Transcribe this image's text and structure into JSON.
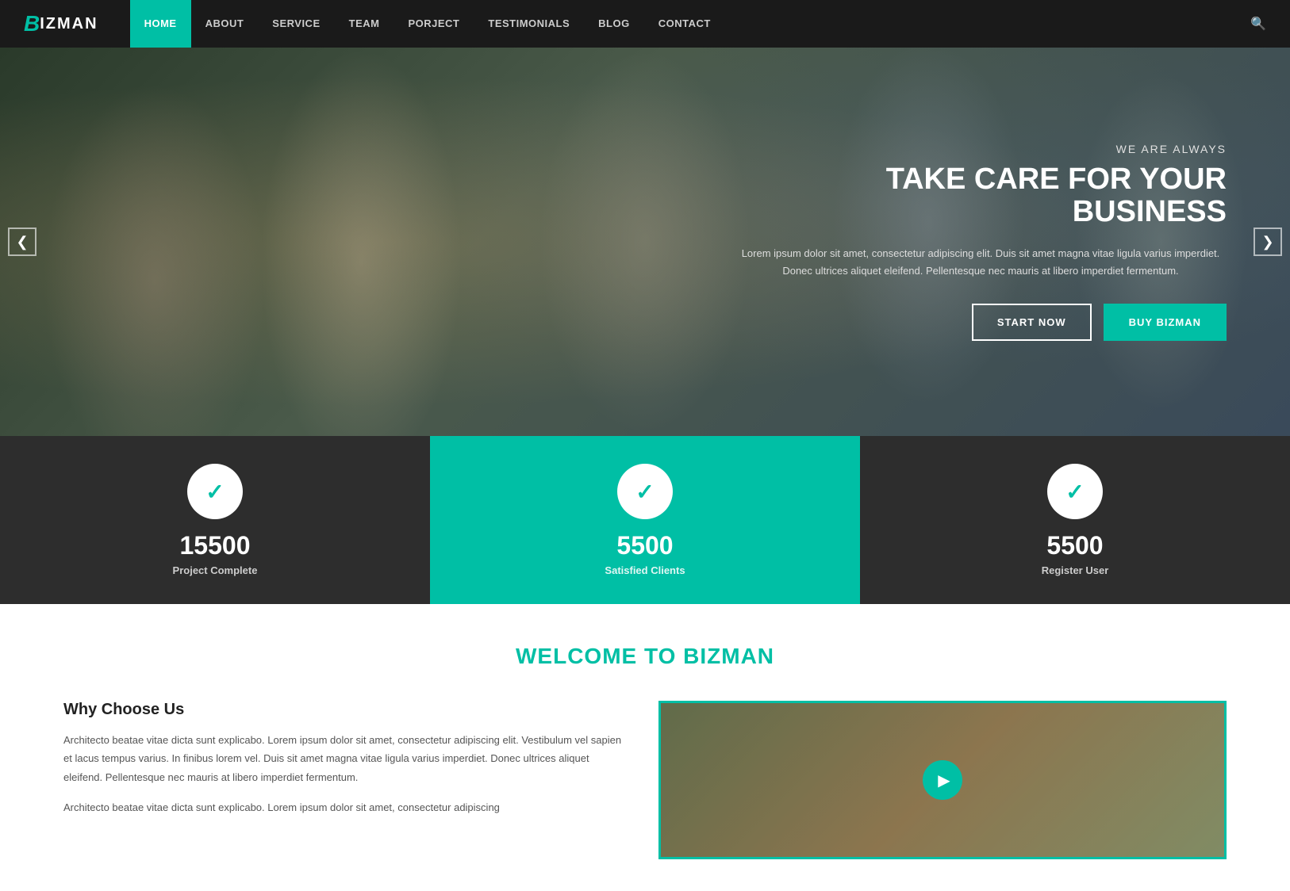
{
  "brand": {
    "letter": "B",
    "name": "IZMAN"
  },
  "nav": {
    "items": [
      {
        "label": "HOME",
        "active": true
      },
      {
        "label": "ABOUT",
        "active": false
      },
      {
        "label": "SERVICE",
        "active": false
      },
      {
        "label": "TEAM",
        "active": false
      },
      {
        "label": "PORJECT",
        "active": false
      },
      {
        "label": "TESTIMONIALS",
        "active": false
      },
      {
        "label": "BLOG",
        "active": false
      },
      {
        "label": "CONTACT",
        "active": false
      }
    ],
    "search_icon": "🔍"
  },
  "hero": {
    "sub": "WE ARE ALWAYS",
    "title": "TAKE CARE FOR YOUR BUSINESS",
    "desc": "Lorem ipsum dolor sit amet, consectetur adipiscing elit. Duis sit amet magna vitae ligula varius imperdiet. Donec ultrices aliquet eleifend. Pellentesque nec mauris at libero imperdiet fermentum.",
    "btn_start": "START NOW",
    "btn_buy": "BUY BIZMAN",
    "arrow_left": "❮",
    "arrow_right": "❯"
  },
  "stats": [
    {
      "number": "15500",
      "label": "Project Complete",
      "id": "projects"
    },
    {
      "number": "5500",
      "label": "Satisfied Clients",
      "id": "clients"
    },
    {
      "number": "5500",
      "label": "Register User",
      "id": "users"
    }
  ],
  "welcome": {
    "title_prefix": "WELCOME TO ",
    "title_brand": "BIZMAN",
    "section_title": "Why Choose Us",
    "para1": "Architecto beatae vitae dicta sunt explicabo. Lorem ipsum dolor sit amet, consectetur adipiscing elit. Vestibulum vel sapien et lacus tempus varius. In finibus lorem vel. Duis sit amet magna vitae ligula varius imperdiet. Donec ultrices aliquet eleifend. Pellentesque nec mauris at libero imperdiet fermentum.",
    "para2": "Architecto beatae vitae dicta sunt explicabo. Lorem ipsum dolor sit amet, consectetur adipiscing"
  },
  "colors": {
    "teal": "#00bfa5",
    "dark": "#1a1a1a",
    "darker": "#2d2d2d"
  }
}
